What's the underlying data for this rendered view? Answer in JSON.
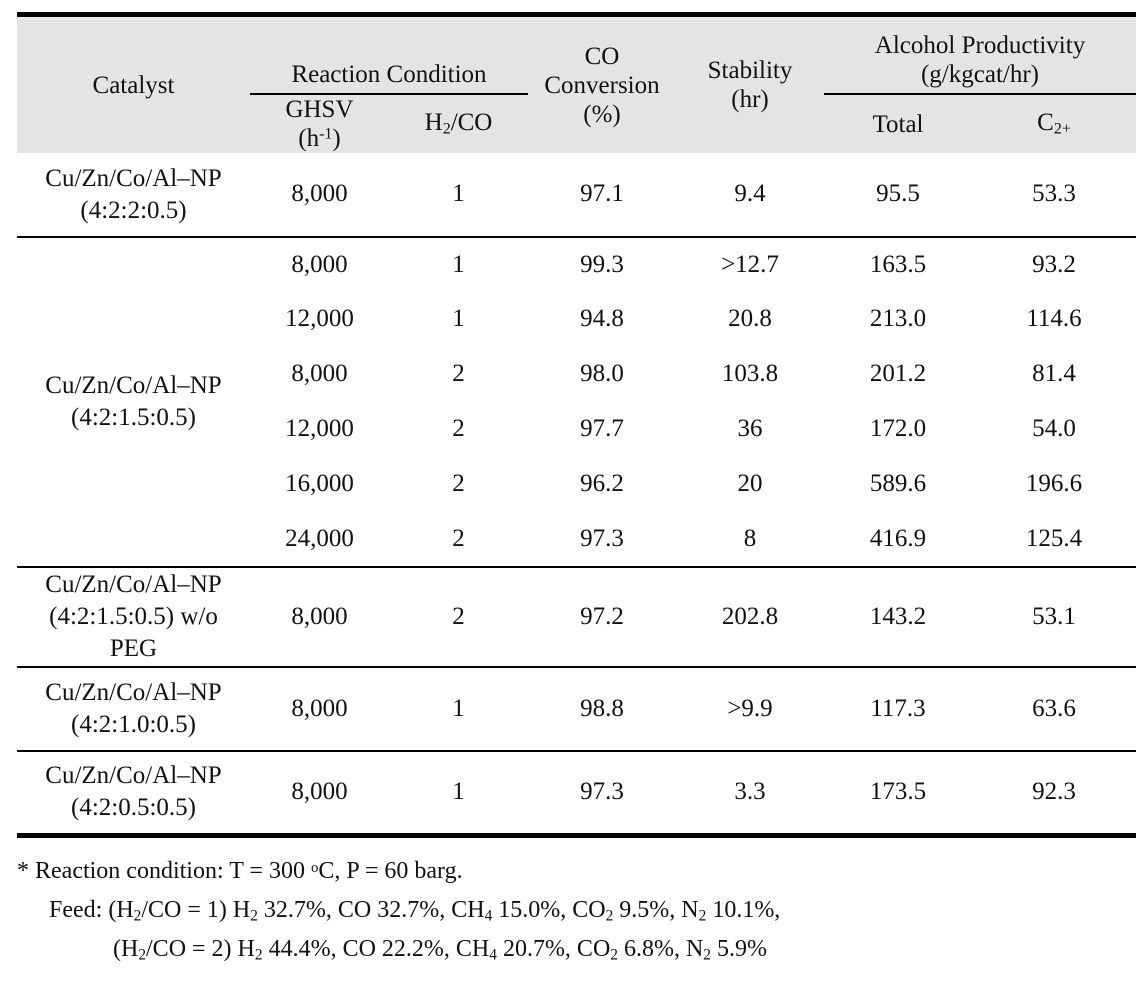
{
  "table": {
    "header": {
      "catalyst": "Catalyst",
      "reaction_condition": "Reaction Condition",
      "ghsv": "GHSV",
      "ghsv_unit": "(h",
      "ghsv_unit_sup": "-1",
      "ghsv_unit_close": ")",
      "h2co": "H",
      "h2co_sub": "2",
      "h2co_rest": "/CO",
      "co_conversion_l1": "CO",
      "co_conversion_l2": "Conversion",
      "co_conversion_l3": "(%)",
      "stability_l1": "Stability",
      "stability_l2": "(hr)",
      "alcohol_productivity_l1": "Alcohol Productivity",
      "alcohol_productivity_l2": "(g/kgcat/hr)",
      "total": "Total",
      "c2plus": "C",
      "c2plus_sub": "2+"
    },
    "sections": [
      {
        "catalyst_l1": "Cu/Zn/Co/Al–NP",
        "catalyst_l2": "(4:2:2:0.5)",
        "catalyst_l3": "",
        "rows": [
          {
            "ghsv": "8,000",
            "h2co": "1",
            "co_conversion": "97.1",
            "stability": "9.4",
            "total": "95.5",
            "c2plus": "53.3"
          }
        ]
      },
      {
        "catalyst_l1": "Cu/Zn/Co/Al–NP",
        "catalyst_l2": "(4:2:1.5:0.5)",
        "catalyst_l3": "",
        "rows": [
          {
            "ghsv": "8,000",
            "h2co": "1",
            "co_conversion": "99.3",
            "stability": ">12.7",
            "total": "163.5",
            "c2plus": "93.2"
          },
          {
            "ghsv": "12,000",
            "h2co": "1",
            "co_conversion": "94.8",
            "stability": "20.8",
            "total": "213.0",
            "c2plus": "114.6"
          },
          {
            "ghsv": "8,000",
            "h2co": "2",
            "co_conversion": "98.0",
            "stability": "103.8",
            "total": "201.2",
            "c2plus": "81.4"
          },
          {
            "ghsv": "12,000",
            "h2co": "2",
            "co_conversion": "97.7",
            "stability": "36",
            "total": "172.0",
            "c2plus": "54.0"
          },
          {
            "ghsv": "16,000",
            "h2co": "2",
            "co_conversion": "96.2",
            "stability": "20",
            "total": "589.6",
            "c2plus": "196.6"
          },
          {
            "ghsv": "24,000",
            "h2co": "2",
            "co_conversion": "97.3",
            "stability": "8",
            "total": "416.9",
            "c2plus": "125.4"
          }
        ]
      },
      {
        "catalyst_l1": "Cu/Zn/Co/Al–NP",
        "catalyst_l2": "(4:2:1.5:0.5) w/o",
        "catalyst_l3": "PEG",
        "rows": [
          {
            "ghsv": "8,000",
            "h2co": "2",
            "co_conversion": "97.2",
            "stability": "202.8",
            "total": "143.2",
            "c2plus": "53.1"
          }
        ]
      },
      {
        "catalyst_l1": "Cu/Zn/Co/Al–NP",
        "catalyst_l2": "(4:2:1.0:0.5)",
        "catalyst_l3": "",
        "rows": [
          {
            "ghsv": "8,000",
            "h2co": "1",
            "co_conversion": "98.8",
            "stability": ">9.9",
            "total": "117.3",
            "c2plus": "63.6"
          }
        ]
      },
      {
        "catalyst_l1": "Cu/Zn/Co/Al–NP",
        "catalyst_l2": "(4:2:0.5:0.5)",
        "catalyst_l3": "",
        "rows": [
          {
            "ghsv": "8,000",
            "h2co": "1",
            "co_conversion": "97.3",
            "stability": "3.3",
            "total": "173.5",
            "c2plus": "92.3"
          }
        ]
      }
    ]
  },
  "notes": {
    "line1_marker": "*",
    "line1": "Reaction condition: T = 300 °C, P = 60 barg.",
    "line2_prefix": "Feed: (H",
    "line2": "Feed: (H2/CO = 1) H2 32.7%, CO 32.7%, CH4 15.0%, CO2 9.5%, N2 10.1%,",
    "line3": "(H2/CO = 2) H2 44.4%, CO 22.2%, CH4 20.7%, CO2 6.8%, N2 5.9%"
  },
  "colors": {
    "header_background": "#e4e4e4",
    "rule": "#000000",
    "text": "#111111",
    "page_background": "#ffffff"
  }
}
